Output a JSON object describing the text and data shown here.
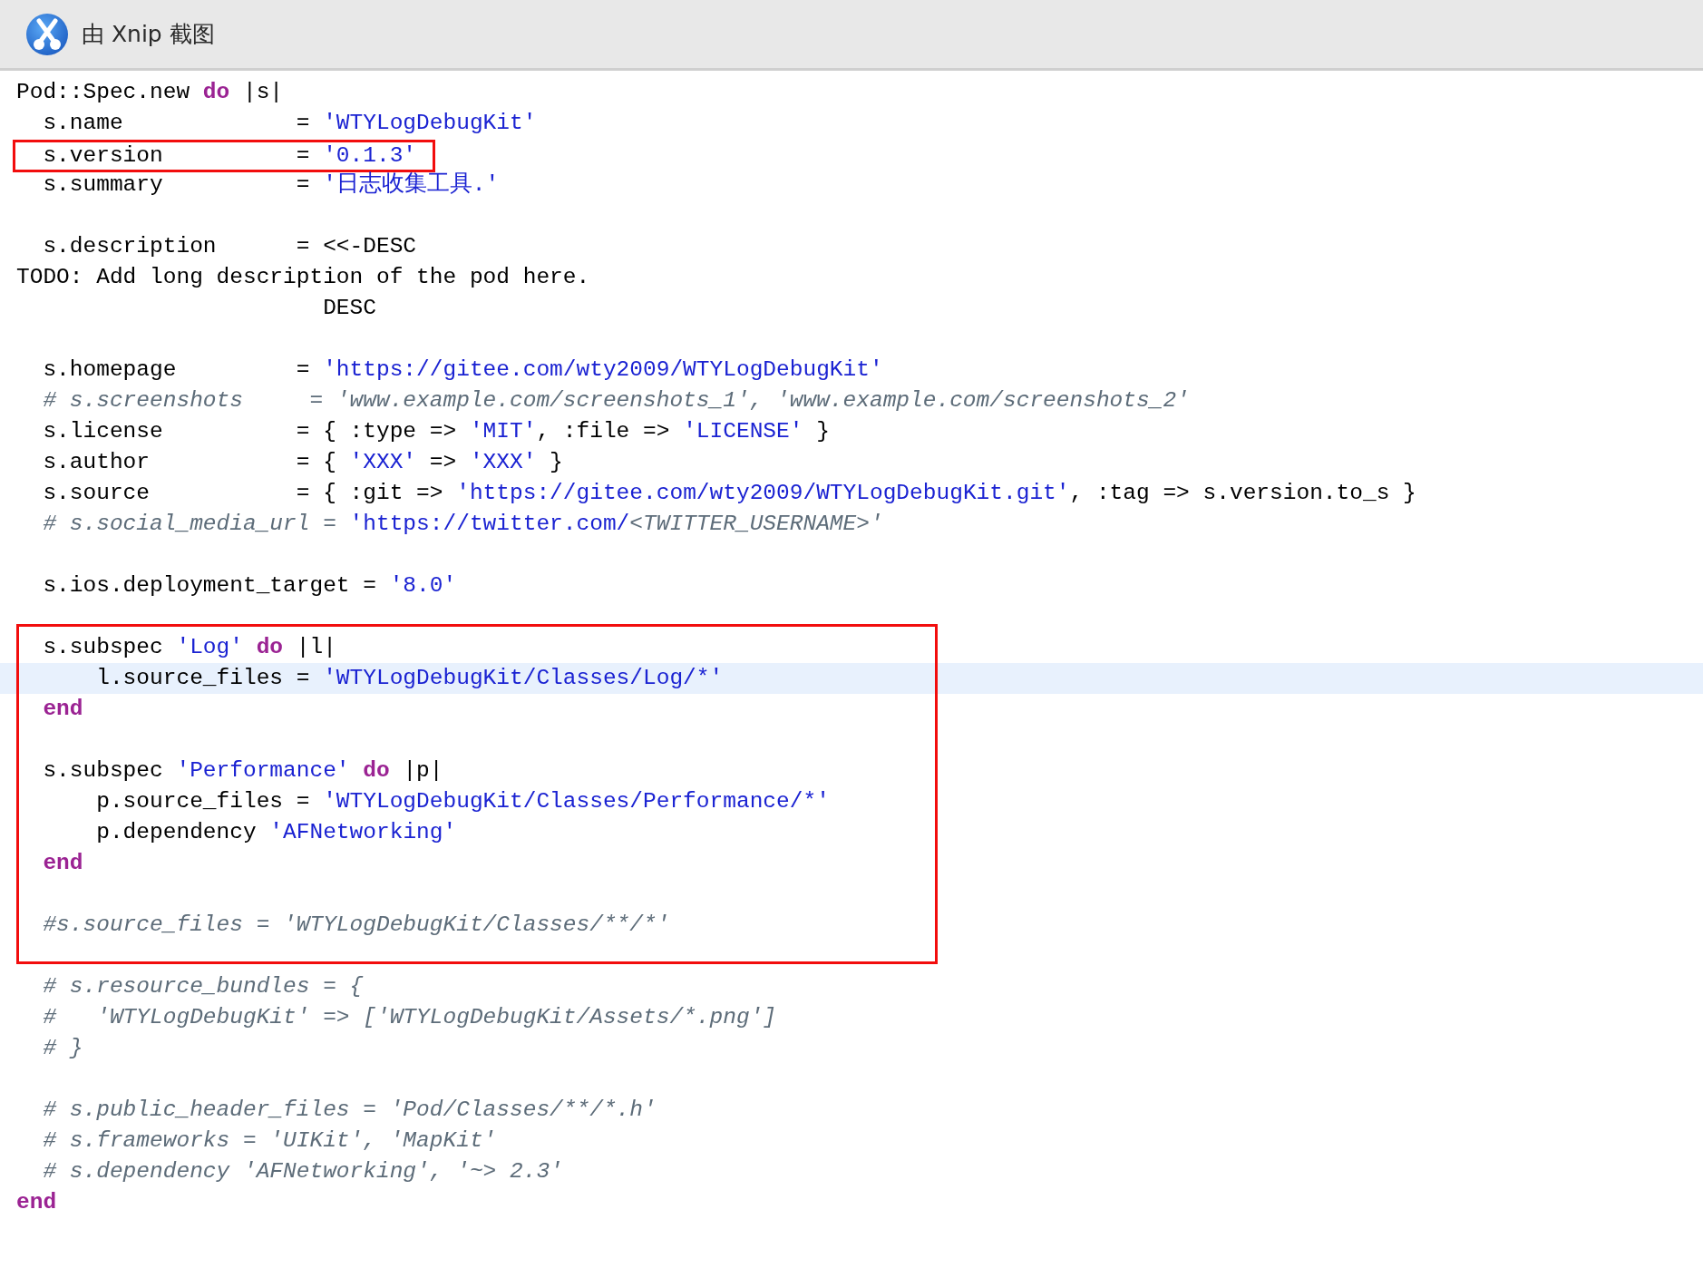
{
  "title_bar": {
    "title": "由 Xnip 截图"
  },
  "editor": {
    "blocks": [
      {
        "kind": "plain",
        "lines": [
          {
            "kind": "code",
            "current": false,
            "tokens": [
              {
                "kind": "plain",
                "text": "Pod::Spec.new "
              },
              {
                "kind": "keyword",
                "text": "do"
              },
              {
                "kind": "plain",
                "text": " |s|"
              }
            ]
          },
          {
            "kind": "code",
            "current": false,
            "tokens": [
              {
                "kind": "plain",
                "text": "  s.name             = "
              },
              {
                "kind": "string",
                "text": "'WTYLogDebugKit'"
              }
            ]
          }
        ]
      },
      {
        "kind": "line",
        "lines": [
          {
            "kind": "code",
            "current": false,
            "tokens": [
              {
                "kind": "plain",
                "text": "  s.version          = "
              },
              {
                "kind": "string",
                "text": "'0.1.3'"
              }
            ]
          }
        ]
      },
      {
        "kind": "plain",
        "lines": [
          {
            "kind": "code",
            "current": false,
            "tokens": [
              {
                "kind": "plain",
                "text": "  s.summary          = "
              },
              {
                "kind": "string",
                "text": "'日志收集工具.'"
              }
            ]
          },
          {
            "kind": "blank"
          },
          {
            "kind": "code",
            "current": false,
            "tokens": [
              {
                "kind": "plain",
                "text": "  s.description      = <<-DESC"
              }
            ]
          },
          {
            "kind": "code",
            "current": false,
            "tokens": [
              {
                "kind": "plain",
                "text": "TODO: Add long description of the pod here."
              }
            ]
          },
          {
            "kind": "code",
            "current": false,
            "tokens": [
              {
                "kind": "plain",
                "text": "                       DESC"
              }
            ]
          },
          {
            "kind": "blank"
          },
          {
            "kind": "code",
            "current": false,
            "tokens": [
              {
                "kind": "plain",
                "text": "  s.homepage         = "
              },
              {
                "kind": "string",
                "text": "'https://gitee.com/wty2009/WTYLogDebugKit'"
              }
            ]
          },
          {
            "kind": "code",
            "current": false,
            "tokens": [
              {
                "kind": "comment",
                "text": "  # s.screenshots     = 'www.example.com/screenshots_1', 'www.example.com/screenshots_2'"
              }
            ]
          },
          {
            "kind": "code",
            "current": false,
            "tokens": [
              {
                "kind": "plain",
                "text": "  s.license          = { :type => "
              },
              {
                "kind": "string",
                "text": "'MIT'"
              },
              {
                "kind": "plain",
                "text": ", :file => "
              },
              {
                "kind": "string",
                "text": "'LICENSE'"
              },
              {
                "kind": "plain",
                "text": " }"
              }
            ]
          },
          {
            "kind": "code",
            "current": false,
            "tokens": [
              {
                "kind": "plain",
                "text": "  s.author           = { "
              },
              {
                "kind": "string",
                "text": "'XXX'"
              },
              {
                "kind": "plain",
                "text": " => "
              },
              {
                "kind": "string",
                "text": "'XXX'"
              },
              {
                "kind": "plain",
                "text": " }"
              }
            ]
          },
          {
            "kind": "code",
            "current": false,
            "tokens": [
              {
                "kind": "plain",
                "text": "  s.source           = { :git => "
              },
              {
                "kind": "string",
                "text": "'https://gitee.com/wty2009/WTYLogDebugKit.git'"
              },
              {
                "kind": "plain",
                "text": ", :tag => s.version.to_s }"
              }
            ]
          },
          {
            "kind": "code",
            "current": false,
            "tokens": [
              {
                "kind": "comment",
                "text": "  # s.social_media_url = "
              },
              {
                "kind": "string",
                "text": "'https://twitter.com/"
              },
              {
                "kind": "comment",
                "text": "<TWITTER_USERNAME>'"
              }
            ]
          },
          {
            "kind": "blank"
          },
          {
            "kind": "code",
            "current": false,
            "tokens": [
              {
                "kind": "plain",
                "text": "  s.ios.deployment_target = "
              },
              {
                "kind": "string",
                "text": "'8.0'"
              }
            ]
          },
          {
            "kind": "blank"
          }
        ]
      },
      {
        "kind": "region",
        "lines": [
          {
            "kind": "code",
            "current": false,
            "tokens": [
              {
                "kind": "plain",
                "text": "  s.subspec "
              },
              {
                "kind": "string",
                "text": "'Log'"
              },
              {
                "kind": "keyword",
                "text": " do"
              },
              {
                "kind": "plain",
                "text": " |l|"
              }
            ]
          },
          {
            "kind": "code",
            "current": true,
            "tokens": [
              {
                "kind": "plain",
                "text": "      l.source_files = "
              },
              {
                "kind": "string",
                "text": "'WTYLogDebugKit/Classes/Log/*'"
              }
            ]
          },
          {
            "kind": "code",
            "current": false,
            "tokens": [
              {
                "kind": "keyword",
                "text": "  end"
              }
            ]
          },
          {
            "kind": "blank"
          },
          {
            "kind": "code",
            "current": false,
            "tokens": [
              {
                "kind": "plain",
                "text": "  s.subspec "
              },
              {
                "kind": "string",
                "text": "'Performance'"
              },
              {
                "kind": "keyword",
                "text": " do"
              },
              {
                "kind": "plain",
                "text": " |p|"
              }
            ]
          },
          {
            "kind": "code",
            "current": false,
            "tokens": [
              {
                "kind": "plain",
                "text": "      p.source_files = "
              },
              {
                "kind": "string",
                "text": "'WTYLogDebugKit/Classes/Performance/*'"
              }
            ]
          },
          {
            "kind": "code",
            "current": false,
            "tokens": [
              {
                "kind": "plain",
                "text": "      p.dependency "
              },
              {
                "kind": "string",
                "text": "'AFNetworking'"
              }
            ]
          },
          {
            "kind": "code",
            "current": false,
            "tokens": [
              {
                "kind": "keyword",
                "text": "  end"
              }
            ]
          },
          {
            "kind": "blank"
          },
          {
            "kind": "code",
            "current": false,
            "tokens": [
              {
                "kind": "comment",
                "text": "  #s.source_files = 'WTYLogDebugKit/Classes/**/*'"
              }
            ]
          }
        ]
      },
      {
        "kind": "plain",
        "lines": [
          {
            "kind": "blank"
          },
          {
            "kind": "code",
            "current": false,
            "tokens": [
              {
                "kind": "comment",
                "text": "  # s.resource_bundles = {"
              }
            ]
          },
          {
            "kind": "code",
            "current": false,
            "tokens": [
              {
                "kind": "comment",
                "text": "  #   'WTYLogDebugKit' => ['WTYLogDebugKit/Assets/*.png']"
              }
            ]
          },
          {
            "kind": "code",
            "current": false,
            "tokens": [
              {
                "kind": "comment",
                "text": "  # }"
              }
            ]
          },
          {
            "kind": "blank"
          },
          {
            "kind": "code",
            "current": false,
            "tokens": [
              {
                "kind": "comment",
                "text": "  # s.public_header_files = 'Pod/Classes/**/*.h'"
              }
            ]
          },
          {
            "kind": "code",
            "current": false,
            "tokens": [
              {
                "kind": "comment",
                "text": "  # s.frameworks = 'UIKit', 'MapKit'"
              }
            ]
          },
          {
            "kind": "code",
            "current": false,
            "tokens": [
              {
                "kind": "comment",
                "text": "  # s.dependency 'AFNetworking', '~> 2.3'"
              }
            ]
          },
          {
            "kind": "code",
            "current": false,
            "tokens": [
              {
                "kind": "keyword",
                "text": "end"
              }
            ]
          }
        ]
      }
    ]
  }
}
